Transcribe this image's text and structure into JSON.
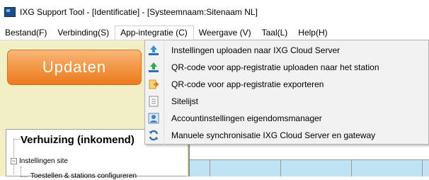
{
  "window": {
    "title": "IXG Support Tool - [Identificatie] - [Systeemnaam:Sitenaam NL]"
  },
  "menubar": {
    "items": [
      {
        "label": "Bestand(F)"
      },
      {
        "label": "Verbinding(S)"
      },
      {
        "label": "App-integratie (C)"
      },
      {
        "label": "Weergave (V)"
      },
      {
        "label": "Taal(L)"
      },
      {
        "label": "Help(H)"
      }
    ]
  },
  "dropdown": {
    "items": [
      {
        "label": "Instellingen uploaden naar IXG Cloud Server",
        "icon": "upload-icon"
      },
      {
        "label": "QR-code voor app-registratie uploaden naar het station",
        "icon": "upload-station-icon"
      },
      {
        "label": "QR-code voor app-registratie exporteren",
        "icon": "export-icon"
      },
      {
        "label": "Sitelijst",
        "icon": "list-icon"
      },
      {
        "label": "Accountinstellingen eigendomsmanager",
        "icon": "account-icon"
      },
      {
        "label": "Manuele synchronisatie IXG Cloud Server en gateway",
        "icon": "sync-icon"
      }
    ]
  },
  "left": {
    "update_label": "Updaten",
    "tree_title": "Verhuizing (inkomend)",
    "tree_node_1": "Instellingen site",
    "tree_node_2": "Toestellen & stations configureren"
  },
  "colors": {
    "update_orange": "#ec7a1d",
    "left_panel_bg": "#f1efc6",
    "grid_blue": "#bfe3f3",
    "menu_bg": "#f2f2f2"
  }
}
